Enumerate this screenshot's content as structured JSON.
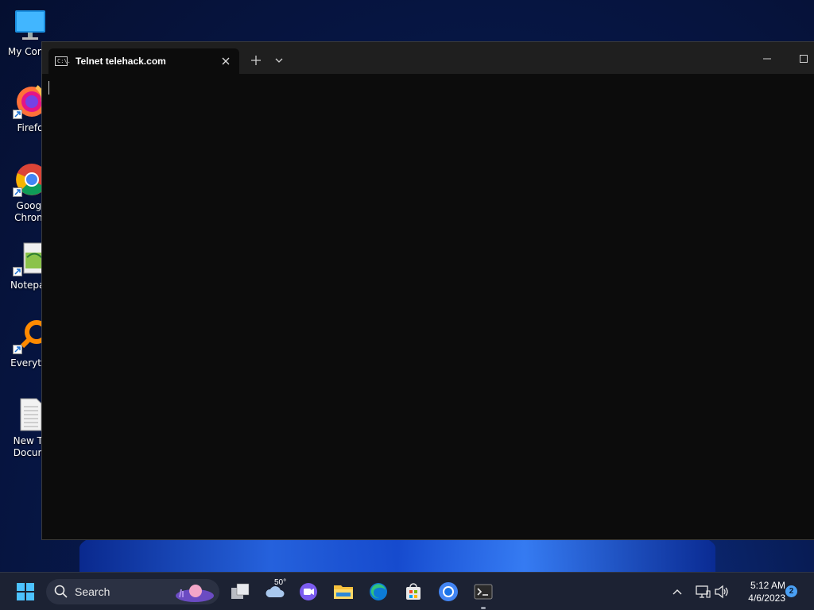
{
  "desktop": {
    "icons": [
      {
        "label": "My Comp"
      },
      {
        "label": "Firefo"
      },
      {
        "label": "Googl Chrom"
      },
      {
        "label": "Notepac"
      },
      {
        "label": "Everythi"
      },
      {
        "label": "New Te Docum"
      }
    ]
  },
  "window": {
    "tab_title": "Telnet telehack.com",
    "tab_icon_text": "C:\\."
  },
  "taskbar": {
    "search_placeholder": "Search",
    "weather_temp": "50°",
    "time": "5:12 AM",
    "date": "4/6/2023",
    "notification_count": "2"
  },
  "colors": {
    "terminal_bg": "#0c0c0c",
    "titlebar_bg": "#1f1f1f",
    "taskbar_bg": "#1c2233"
  }
}
